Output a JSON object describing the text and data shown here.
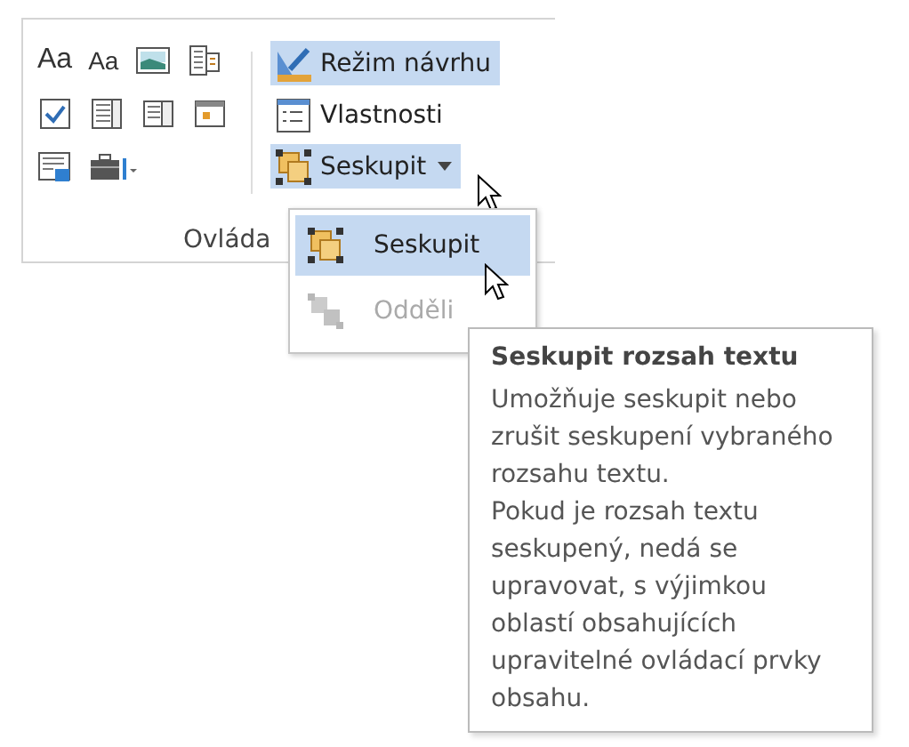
{
  "ribbon_group": {
    "label": "Ovláda",
    "tools": [
      {
        "kind": "rich-text",
        "text": "Aa"
      },
      {
        "kind": "plain-text",
        "text": "Aa"
      },
      {
        "kind": "picture"
      },
      {
        "kind": "gallery"
      },
      {
        "kind": "checkbox"
      },
      {
        "kind": "combo"
      },
      {
        "kind": "list"
      },
      {
        "kind": "date"
      },
      {
        "kind": "repeat"
      },
      {
        "kind": "legacy"
      }
    ],
    "buttons": [
      {
        "kind": "design",
        "label": "Režim návrhu",
        "selected": true,
        "has_menu": false
      },
      {
        "kind": "properties",
        "label": "Vlastnosti",
        "selected": false,
        "has_menu": false
      },
      {
        "kind": "group",
        "label": "Seskupit",
        "selected": true,
        "has_menu": true
      }
    ]
  },
  "menu": {
    "items": [
      {
        "kind": "group",
        "label": "Seskupit",
        "selected": true,
        "disabled": false
      },
      {
        "kind": "ungroup",
        "label": "Odděli",
        "selected": false,
        "disabled": true
      }
    ]
  },
  "tooltip": {
    "title": "Seskupit rozsah textu",
    "paragraphs": [
      "Umožňuje seskupit nebo zrušit seskupení vybraného rozsahu textu.",
      "Pokud je rozsah textu seskupený, nedá se upravovat, s výjimkou oblastí obsahujících upravitelné ovládací prvky obsahu."
    ]
  }
}
